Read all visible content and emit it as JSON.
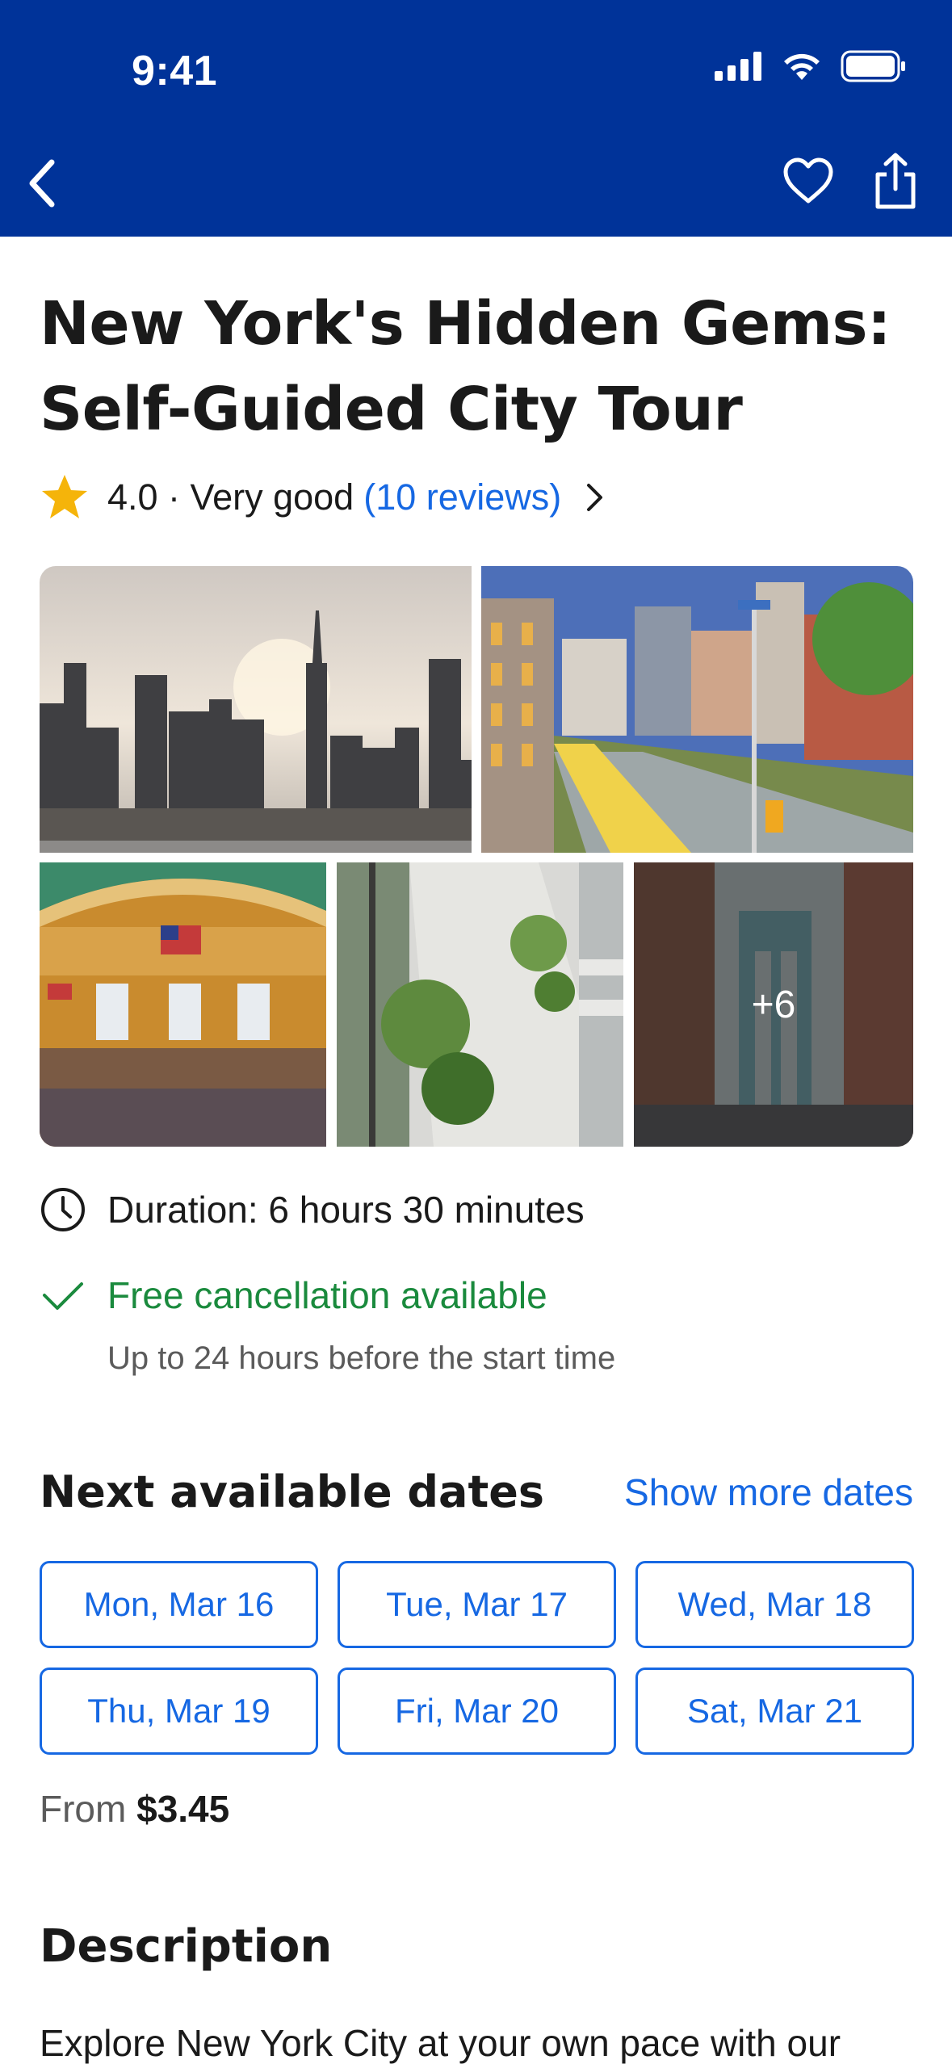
{
  "status_bar": {
    "time": "9:41"
  },
  "nav": {
    "back_icon": "chevron-left-icon",
    "favorite_icon": "heart-icon",
    "share_icon": "share-icon"
  },
  "activity": {
    "title": "New York's Hidden Gems: Self-Guided City Tour",
    "rating": "4.0 · Very good",
    "reviews": "(10 reviews)",
    "gallery": {
      "photos": [
        "city skyline at sunrise",
        "elevated park walkway",
        "grand terminal hall",
        "atrium garden from above",
        "bridge between brick buildings"
      ],
      "more_count": "+6"
    },
    "duration": "Duration: 6 hours 30 minutes",
    "cancellation": {
      "title": "Free cancellation available",
      "subtitle": "Up to 24 hours before the start time"
    }
  },
  "dates": {
    "title": "Next available dates",
    "show_more": "Show more dates",
    "items": [
      "Mon, Mar 16",
      "Tue, Mar 17",
      "Wed, Mar 18",
      "Thu, Mar 19",
      "Fri, Mar 20",
      "Sat, Mar 21"
    ]
  },
  "price": {
    "prefix": "From",
    "amount": "$3.45"
  },
  "description": {
    "title": "Description",
    "text": "Explore New York City at your own pace with our"
  },
  "colors": {
    "header_bg": "#003399",
    "link_blue": "#1668e3",
    "success_green": "#1a8a3d",
    "star_yellow": "#f5b40a"
  }
}
